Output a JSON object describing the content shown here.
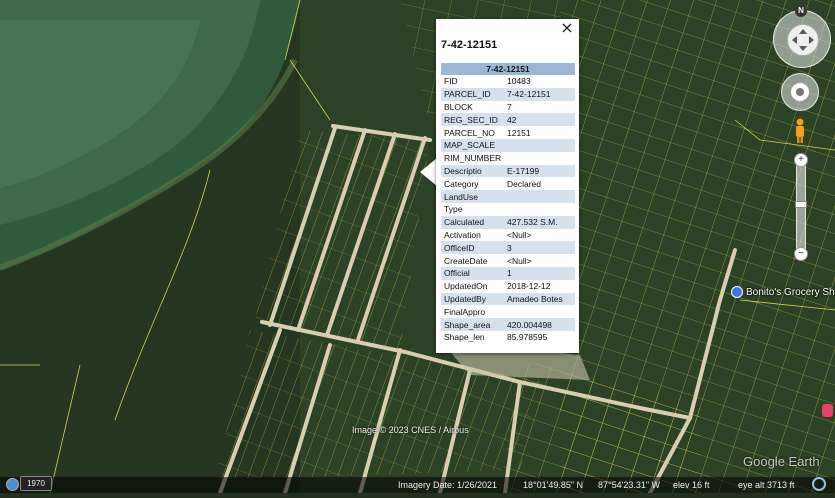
{
  "balloon": {
    "title": "7-42-12151",
    "table_header": "7-42-12151",
    "close_label": "×",
    "rows": [
      {
        "key": "FID",
        "value": "10483"
      },
      {
        "key": "PARCEL_ID",
        "value": "7-42-12151"
      },
      {
        "key": "BLOCK",
        "value": "7"
      },
      {
        "key": "REG_SEC_ID",
        "value": "42"
      },
      {
        "key": "PARCEL_NO",
        "value": "12151"
      },
      {
        "key": "MAP_SCALE",
        "value": ""
      },
      {
        "key": "RIM_NUMBER",
        "value": ""
      },
      {
        "key": "Descriptio",
        "value": "E-17199"
      },
      {
        "key": "Category",
        "value": "Declared"
      },
      {
        "key": "LandUse",
        "value": ""
      },
      {
        "key": "Type",
        "value": ""
      },
      {
        "key": "Calculated",
        "value": "427.532 S.M."
      },
      {
        "key": "Activation",
        "value": "<Null>"
      },
      {
        "key": "OfficeID",
        "value": "3"
      },
      {
        "key": "CreateDate",
        "value": "<Null>"
      },
      {
        "key": "Official",
        "value": "1"
      },
      {
        "key": "UpdatedOn",
        "value": "2018-12-12"
      },
      {
        "key": "UpdatedBy",
        "value": "Amadeo Botes"
      },
      {
        "key": "FinalAppro",
        "value": ""
      },
      {
        "key": "Shape_area",
        "value": "420.004498"
      },
      {
        "key": "Shape_len",
        "value": "85.978595"
      }
    ]
  },
  "map": {
    "place_label": "Bonito's Grocery Sh",
    "copyright": "Image © 2023 CNES / Airbus",
    "brand": "Google Earth"
  },
  "nav": {
    "compass_north": "N",
    "zoom_plus": "+",
    "zoom_minus": "−"
  },
  "status_bar": {
    "historical_year": "1970",
    "imagery_date": "Imagery Date: 1/26/2021",
    "latitude": "18°01'49.85\" N",
    "longitude": "87°54'23.31\" W",
    "elevation": "elev   16 ft",
    "eye_alt": "eye alt   3713 ft"
  },
  "colors": {
    "parcel_lines": "#e8e35a",
    "table_header": "#9cb6d6",
    "table_alt_row": "#d6e1ef"
  }
}
